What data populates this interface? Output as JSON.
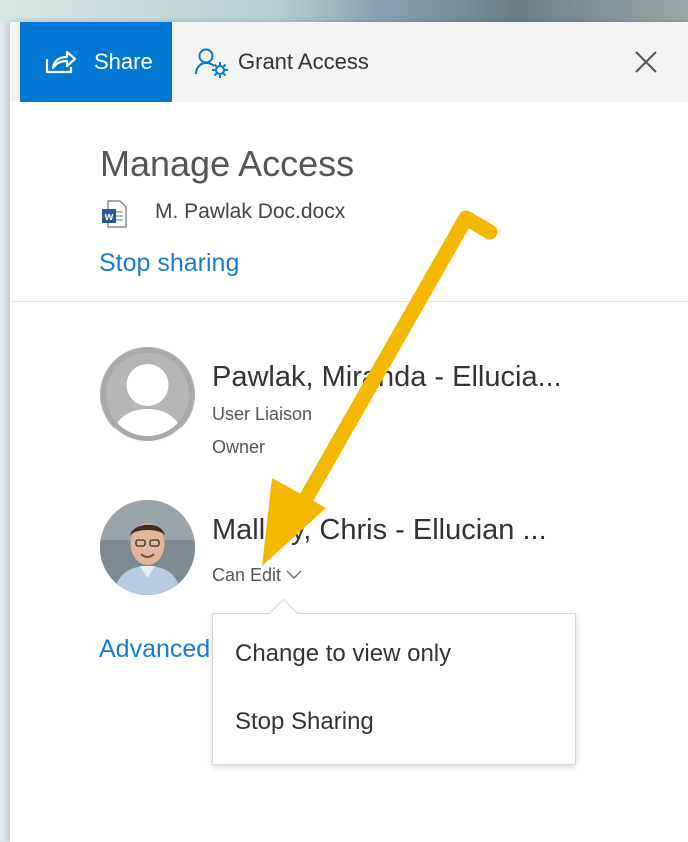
{
  "tabs": {
    "share_label": "Share",
    "grant_label": "Grant Access"
  },
  "panel": {
    "title": "Manage Access",
    "document_name": "M. Pawlak Doc.docx",
    "stop_sharing_link": "Stop sharing",
    "advanced_link": "Advanced"
  },
  "people": [
    {
      "name": "Pawlak, Miranda - Ellucia...",
      "role": "User Liaison",
      "status": "Owner"
    },
    {
      "name": "Mallory, Chris - Ellucian ...",
      "permission": "Can Edit"
    }
  ],
  "permission_menu": {
    "items": [
      "Change to view only",
      "Stop Sharing"
    ]
  },
  "icons": [
    "share-icon",
    "grant-access-icon",
    "close-icon",
    "word-doc-icon",
    "chevron-down-icon",
    "avatar-placeholder-icon"
  ],
  "colors": {
    "accent": "#0078d4",
    "link": "#1b7bd0",
    "annotation_arrow": "#f5b800"
  }
}
